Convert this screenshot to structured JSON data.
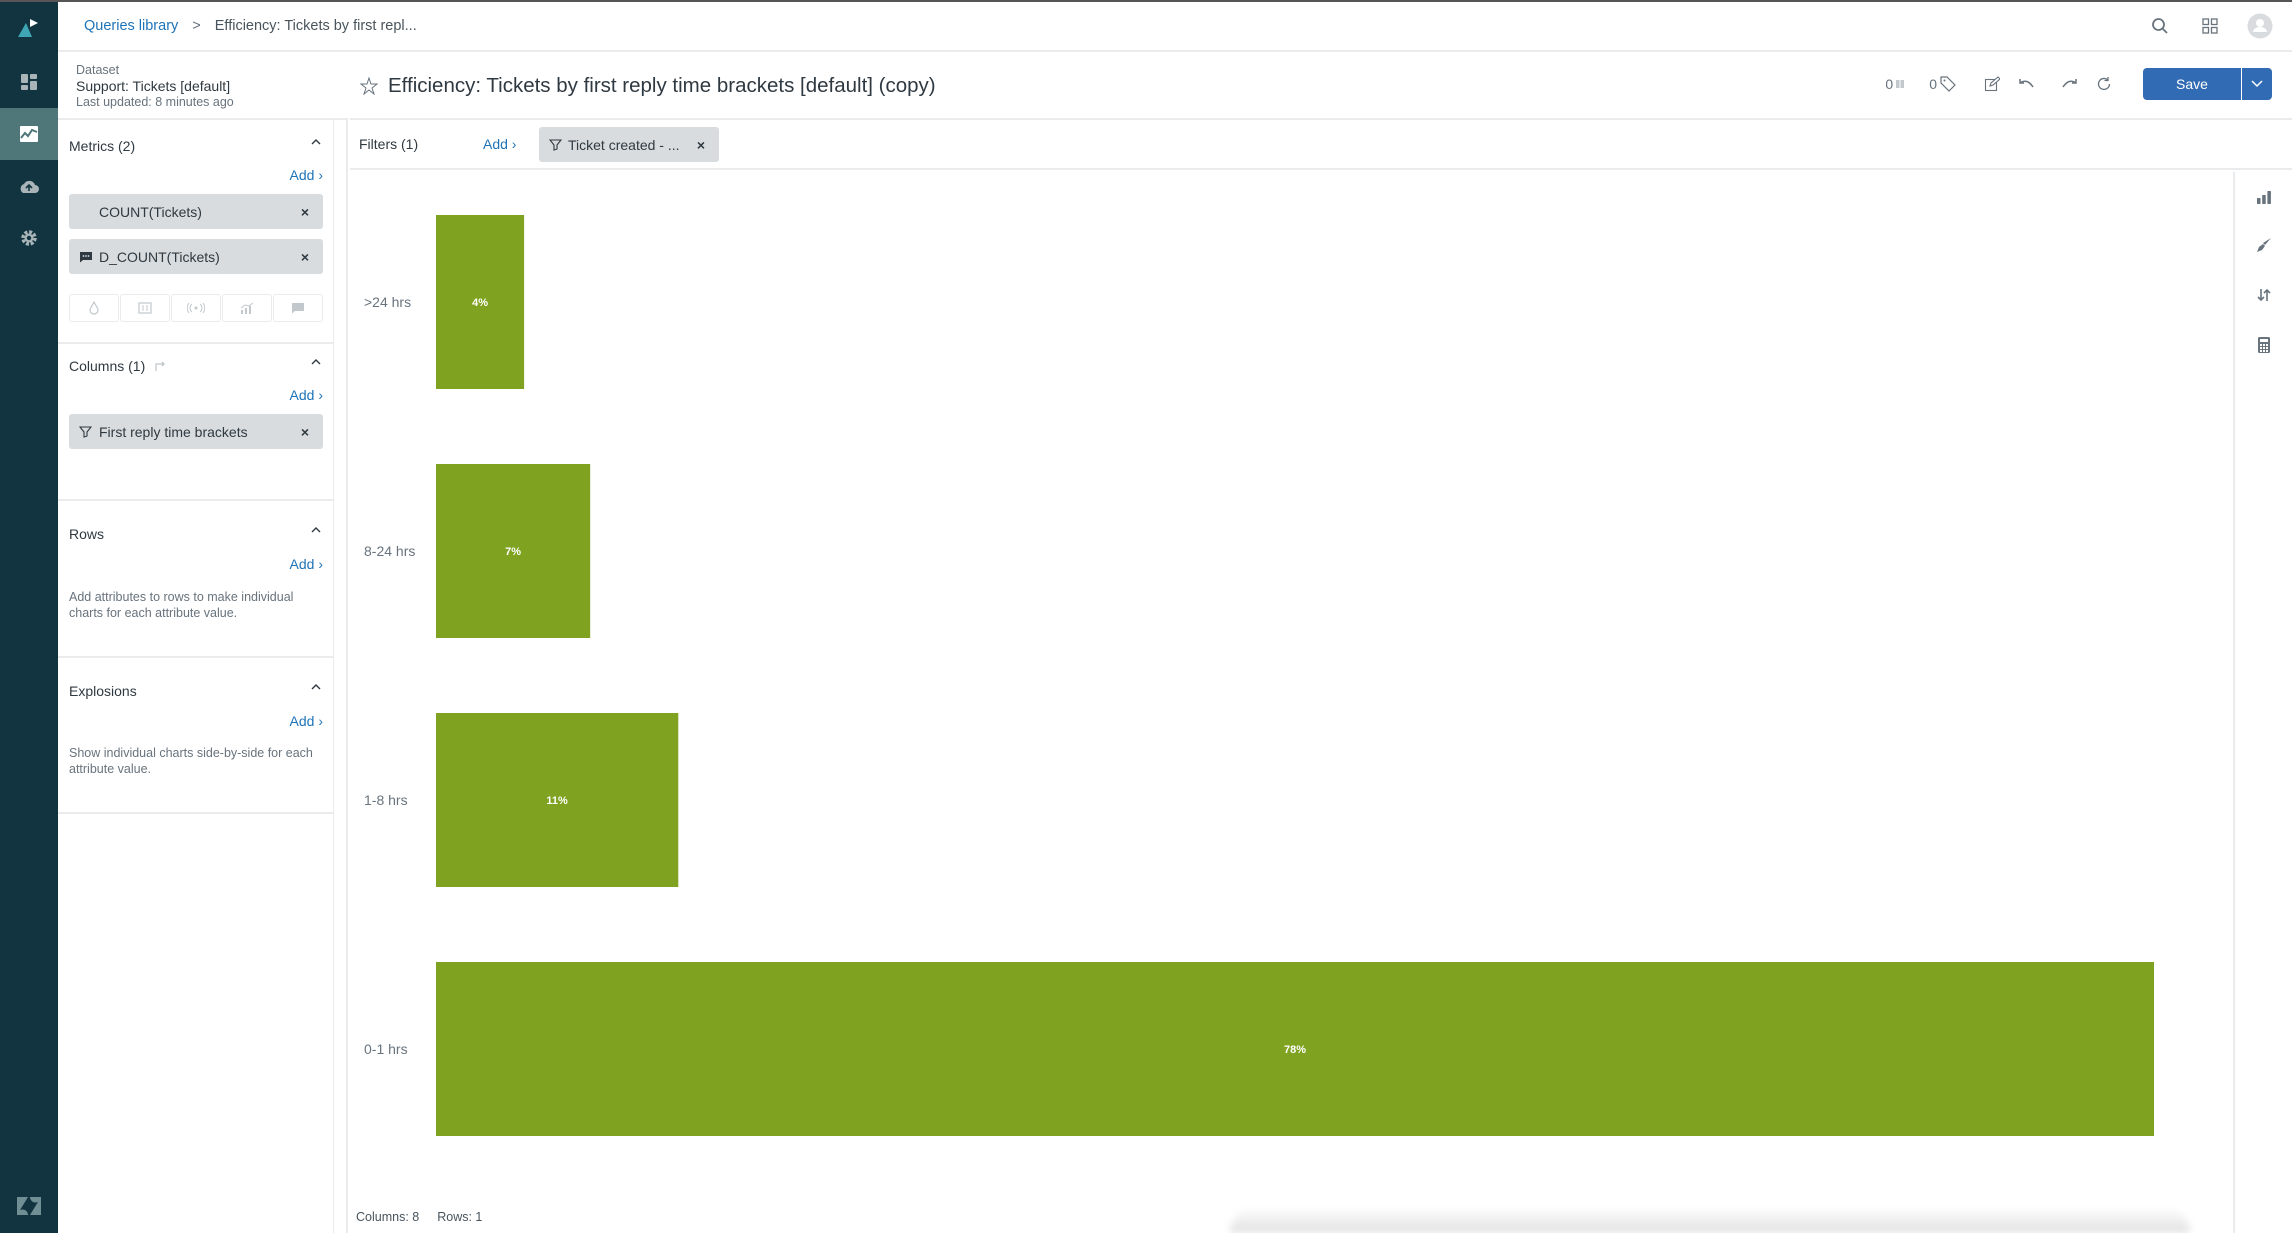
{
  "breadcrumb": {
    "root": "Queries library",
    "separator": ">",
    "current": "Efficiency: Tickets by first repl..."
  },
  "top_icons": [
    "search-icon",
    "apps-grid-icon",
    "user-avatar-icon"
  ],
  "nav": {
    "items": [
      {
        "name": "logo",
        "icon": "explore-logo-icon"
      },
      {
        "name": "dashboards",
        "icon": "dashboard-icon"
      },
      {
        "name": "reports",
        "icon": "chart-line-icon",
        "active": true
      },
      {
        "name": "datasets",
        "icon": "cloud-upload-icon"
      },
      {
        "name": "admin",
        "icon": "gear-icon"
      }
    ],
    "footer_icon": "zendesk-logo-icon"
  },
  "dataset": {
    "label": "Dataset",
    "name": "Support: Tickets [default]",
    "updated": "Last updated: 8 minutes ago"
  },
  "query": {
    "title": "Efficiency: Tickets by first reply time brackets [default] (copy)",
    "widgets_count": "0",
    "tags_count": "0",
    "save_label": "Save"
  },
  "sidebar": {
    "add_label": "Add ›",
    "metrics": {
      "title": "Metrics (2)",
      "items": [
        {
          "label": "COUNT(Tickets)",
          "icon": null
        },
        {
          "label": "D_COUNT(Tickets)",
          "icon": "comment-icon"
        }
      ],
      "viz_buttons": [
        "drop-icon",
        "text-columns-icon",
        "broadcast-icon",
        "bar-trend-icon",
        "comment-icon"
      ]
    },
    "columns": {
      "title": "Columns (1)",
      "items": [
        {
          "label": "First reply time brackets",
          "icon": "filter-icon"
        }
      ]
    },
    "rows": {
      "title": "Rows",
      "helper": "Add attributes to rows to make individual charts for each attribute value."
    },
    "explosions": {
      "title": "Explosions",
      "helper": "Show individual charts side-by-side for each attribute value."
    }
  },
  "filters": {
    "label": "Filters (1)",
    "add_label": "Add ›",
    "items": [
      {
        "label": "Ticket created - ...",
        "icon": "filter-icon"
      }
    ]
  },
  "footer": {
    "columns": "Columns: 8",
    "rows": "Rows: 1"
  },
  "tool_rail": [
    "chart-type-icon",
    "paintbrush-icon",
    "sort-icon",
    "calculator-icon"
  ],
  "colors": {
    "bar": "#7fa321",
    "nav_bg": "#113440",
    "nav_active": "#4f7779",
    "primary": "#316bb3",
    "link": "#1f73b7"
  },
  "chart_data": {
    "type": "bar",
    "orientation": "horizontal",
    "categories": [
      ">24 hrs",
      "8-24 hrs",
      "1-8 hrs",
      "0-1 hrs"
    ],
    "values": [
      4,
      7,
      11,
      78
    ],
    "value_labels": [
      "4%",
      "7%",
      "11%",
      "78%"
    ],
    "unit": "%",
    "title": "",
    "xlabel": "",
    "ylabel": "",
    "xlim": [
      0,
      78
    ],
    "grid": false,
    "legend": "none"
  }
}
